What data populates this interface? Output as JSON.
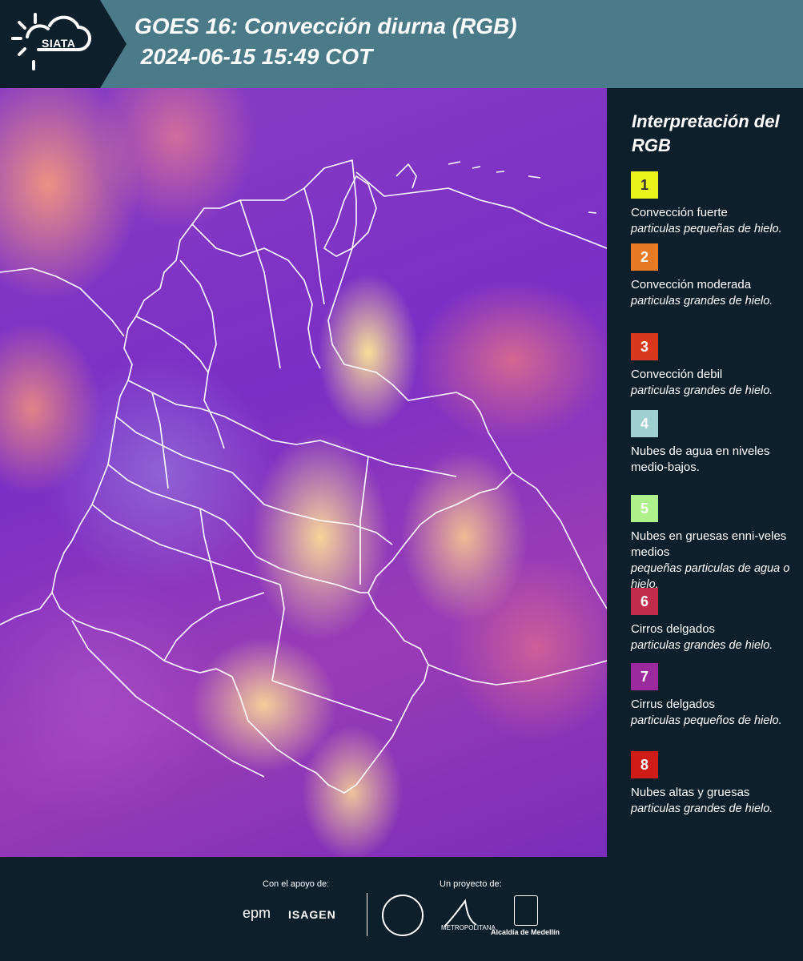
{
  "header": {
    "logo": "SIATA",
    "title_line1": "GOES 16: Convección diurna (RGB)",
    "title_line2": " 2024-06-15 15:49 COT"
  },
  "legend": {
    "title": "Interpretación del RGB",
    "items": [
      {
        "number": "1",
        "color": "#e9f21a",
        "numcolor": "#333333",
        "label": "Convección fuerte",
        "desc": "particulas pequeñas de hielo."
      },
      {
        "number": "2",
        "color": "#e77a22",
        "numcolor": "#ffffff",
        "label": "Convección moderada",
        "desc": "particulas grandes de hielo."
      },
      {
        "number": "3",
        "color": "#d9381c",
        "numcolor": "#ffffff",
        "label": "Convección debil",
        "desc": "particulas grandes de hielo."
      },
      {
        "number": "4",
        "color": "#9fcfcf",
        "numcolor": "#ffffff",
        "label": "Nubes de agua en niveles medio-bajos.",
        "desc": ""
      },
      {
        "number": "5",
        "color": "#aef08a",
        "numcolor": "#ffffff",
        "label": "Nubes en gruesas enni-veles medios",
        "desc": "pequeñas particulas de agua o hielo."
      },
      {
        "number": "6",
        "color": "#c12c4c",
        "numcolor": "#ffffff",
        "label": "Cirros delgados",
        "desc": "particulas grandes de hielo."
      },
      {
        "number": "7",
        "color": "#9b2a9e",
        "numcolor": "#ffffff",
        "label": "Cirrus delgados",
        "desc": "particulas pequeños de hielo."
      },
      {
        "number": "8",
        "color": "#cf1c16",
        "numcolor": "#ffffff",
        "label": "Nubes altas y gruesas",
        "desc": "particulas grandes de hielo."
      }
    ]
  },
  "footer": {
    "support_label": "Con el apoyo de:",
    "project_label": "Un proyecto de:",
    "sponsor1": "epm",
    "sponsor2": "ISAGEN",
    "partner1": "METROPOLITANA",
    "partner2": "Alcaldía de Medellín"
  }
}
